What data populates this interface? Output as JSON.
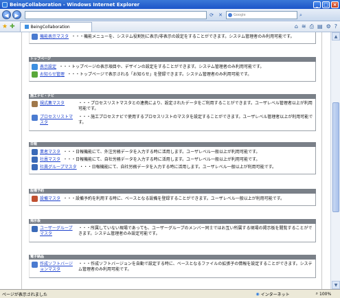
{
  "window": {
    "title": "BeingCollaboration - Windows Internet Explorer"
  },
  "address": {
    "search_placeholder": "Google"
  },
  "tab": {
    "label": "BeingCollaboration"
  },
  "sections": [
    {
      "header": "",
      "entries": [
        {
          "link": "機能表示マスタ",
          "desc": "・・・機能メニューを、システム役割別に表示/非表示の設定をすることができます。システム管理者のみ利用可能です。",
          "icon_color": "#4a7bd0"
        }
      ]
    },
    {
      "header": "トップページ",
      "entries": [
        {
          "link": "表示設定",
          "desc": "・・・トップページの表示項目や、デザインの設定をすることができます。システム管理者のみ利用可能です。",
          "icon_color": "#3d8fe0"
        },
        {
          "link": "お知らせ管理",
          "desc": "・・・トップページで表示される「お知らせ」を登録できます。システム管理者のみ利用可能です。",
          "icon_color": "#5aa83a"
        }
      ]
    },
    {
      "header": "施工ナビ・ナビ",
      "entries": [
        {
          "link": "規式集マスタ",
          "desc": "・・・プロセスリストマスタとの連携により、設定されたデータをご利用することができます。ユーザレベル管理者以上が利用可能です。",
          "icon_color": "#a0784a"
        },
        {
          "link": "プロセスリストマスタ",
          "desc": "・・・施工プロセスナビで使用するプロセスリストのマスタを設定することができます。ユーザレベル管理者以上が利用可能です。",
          "icon_color": "#4a7bd0"
        }
      ]
    },
    {
      "header": "日報",
      "entries": [
        {
          "link": "業者マスタ",
          "desc": "・・・日報機能にて、外注労務データを入力する時に活用します。ユーザレベル一般以上が利用可能です。",
          "icon_color": "#3a6ab8"
        },
        {
          "link": "社員マスタ",
          "desc": "・・・日報機能にて、自社労務データを入力する時に活用します。ユーザレベル一般以上が利用可能です。",
          "icon_color": "#3a6ab8"
        },
        {
          "link": "社員グループマスタ",
          "desc": "・・・日報機能にて、自社労務データを入力する時に活用します。ユーザレベル一般以上が利用可能です。",
          "icon_color": "#3a6ab8"
        }
      ]
    },
    {
      "header": "設備予約",
      "entries": [
        {
          "link": "設備マスタ",
          "desc": "・・・設備予約を利用する時に、ベースとなる設備を登録することができます。ユーザレベル一般以上が利用可能です。",
          "icon_color": "#c05030"
        }
      ]
    },
    {
      "header": "掲示板",
      "entries": [
        {
          "link": "ユーザーグループマスタ",
          "desc": "・・・所属していない現場であっても、ユーザーグループのメンバー同士ではお互い所属する現場の掲示板を閲覧することができます。システム管理者のみ設定可能です。",
          "icon_color": "#3a6ab8"
        }
      ]
    },
    {
      "header": "電子納品",
      "entries": [
        {
          "link": "作成ソフトバージョンマスタ",
          "desc": "・・・作成ソフトバージョンを自動で設定する時に、ベースとなるファイルの拡張子の情報を設定することができます。システム管理者のみ利用可能です。",
          "icon_color": "#4a7bd0"
        }
      ]
    }
  ],
  "status": {
    "text": "ページが表示されました",
    "zone": "インターネット",
    "zoom": "100%"
  }
}
